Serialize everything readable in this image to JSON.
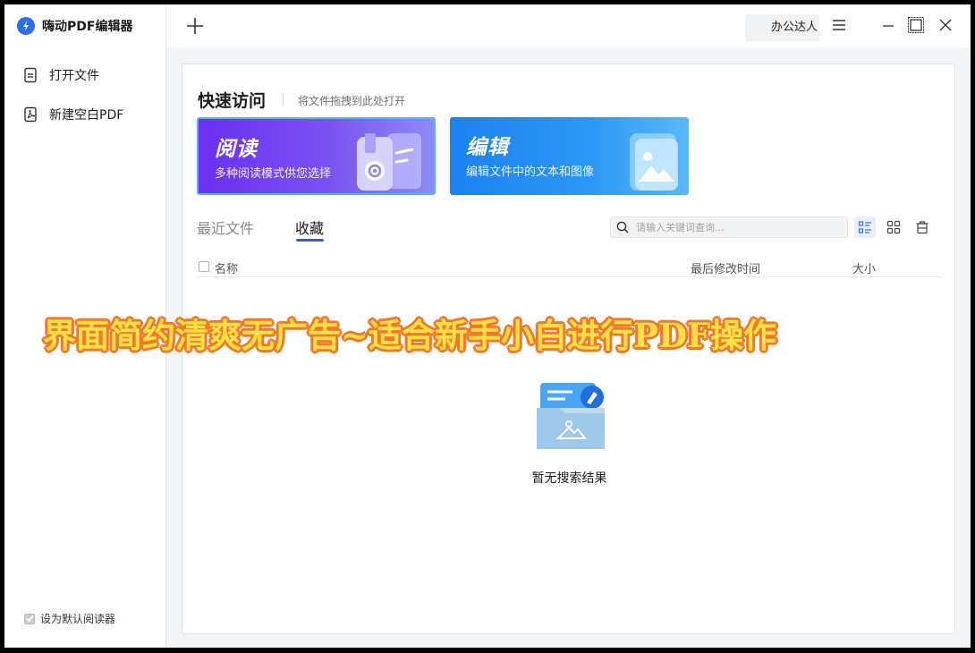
{
  "app": {
    "title": "嗨动PDF编辑器"
  },
  "sidebar": {
    "items": [
      {
        "label": "打开文件",
        "icon": "document-icon"
      },
      {
        "label": "新建空白PDF",
        "icon": "pdf-file-icon"
      }
    ],
    "default_reader": {
      "label": "设为默认阅读器",
      "checked": true
    }
  },
  "topbar": {
    "user_label": "办公达人"
  },
  "quick_access": {
    "title": "快速访问",
    "hint": "将文件拖拽到此处打开",
    "cards": [
      {
        "title": "阅读",
        "subtitle": "多种阅读模式供您选择"
      },
      {
        "title": "编辑",
        "subtitle": "编辑文件中的文本和图像"
      }
    ]
  },
  "tabs": [
    {
      "label": "最近文件",
      "active": false
    },
    {
      "label": "收藏",
      "active": true
    }
  ],
  "search": {
    "placeholder": "请输入关键词查询..."
  },
  "table": {
    "columns": [
      "名称",
      "最后修改时间",
      "大小"
    ]
  },
  "empty_state": {
    "text": "暂无搜索结果"
  },
  "overlay_caption": "界面简约清爽无广告~适合新手小白进行PDF操作",
  "colors": {
    "accent": "#2260e6",
    "read_card": "#6b2ff0",
    "edit_card": "#1c82f0",
    "caption_fill": "#fde047",
    "caption_stroke": "#f07a2a"
  }
}
